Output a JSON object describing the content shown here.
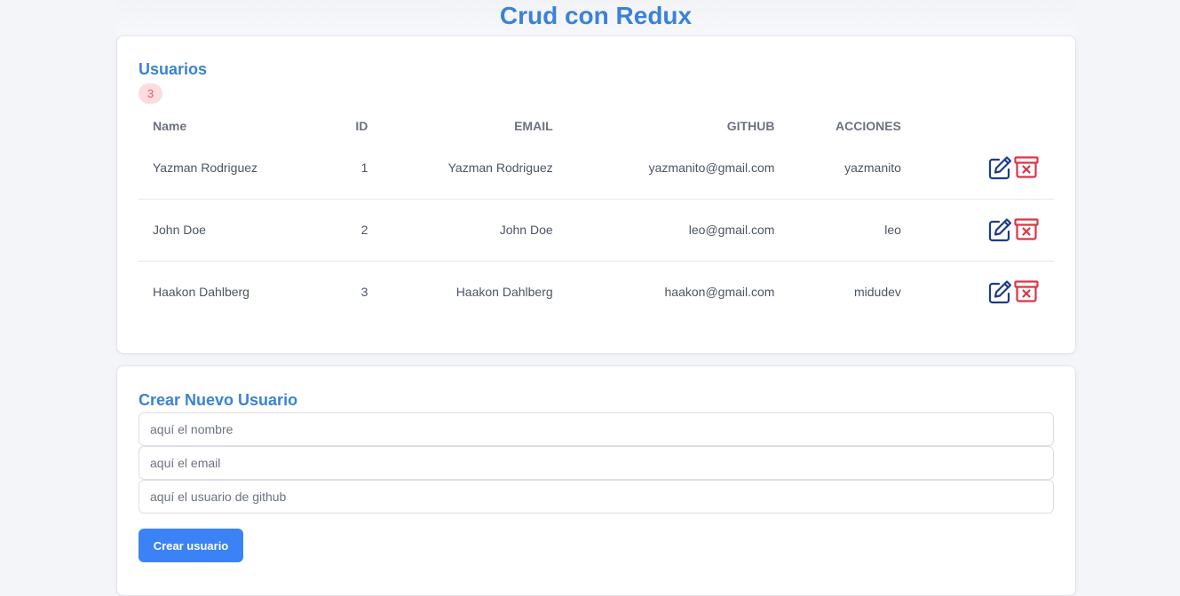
{
  "app": {
    "title": "Crud con Redux"
  },
  "users_section": {
    "title": "Usuarios",
    "count": "3",
    "columns": [
      "Name",
      "ID",
      "EMAIL",
      "GITHUB",
      "ACCIONES"
    ],
    "rows": [
      {
        "name": "Yazman Rodriguez",
        "id": "1",
        "email_col": "Yazman Rodriguez",
        "github_col": "yazmanito@gmail.com",
        "acciones_col": "yazmanito"
      },
      {
        "name": "John Doe",
        "id": "2",
        "email_col": "John Doe",
        "github_col": "leo@gmail.com",
        "acciones_col": "leo"
      },
      {
        "name": "Haakon Dahlberg",
        "id": "3",
        "email_col": "Haakon Dahlberg",
        "github_col": "haakon@gmail.com",
        "acciones_col": "midudev"
      }
    ],
    "icons": {
      "edit": "edit-icon",
      "delete": "delete-icon"
    }
  },
  "form_section": {
    "title": "Crear Nuevo Usuario",
    "name_placeholder": "aquí el nombre",
    "email_placeholder": "aquí el email",
    "github_placeholder": "aquí el usuario de github",
    "submit_label": "Crear usuario"
  },
  "colors": {
    "accent": "#3b82d6",
    "button": "#3b82f6",
    "edit_icon": "#1e3a8a",
    "delete_icon": "#dc3545",
    "badge_bg": "#fbdde0"
  }
}
